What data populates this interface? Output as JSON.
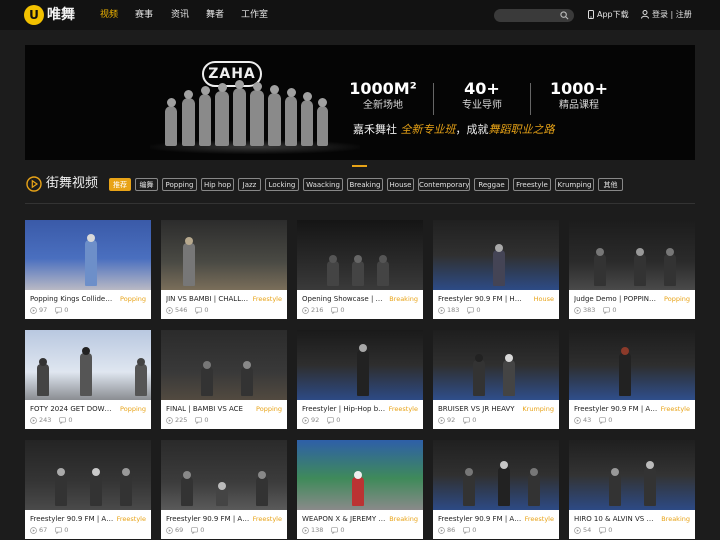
{
  "header": {
    "logo_badge": "U",
    "logo_text": "唯舞",
    "nav": [
      {
        "label": "视频",
        "active": true
      },
      {
        "label": "赛事",
        "active": false
      },
      {
        "label": "资讯",
        "active": false
      },
      {
        "label": "舞者",
        "active": false
      },
      {
        "label": "工作室",
        "active": false
      }
    ],
    "search_placeholder": "",
    "app_download": "App下载",
    "login": "登录 | 注册"
  },
  "banner": {
    "logo": "ZAHA",
    "stats": [
      {
        "num": "1000M²",
        "label": "全新场地"
      },
      {
        "num": "40+",
        "label": "专业导师"
      },
      {
        "num": "1000+",
        "label": "精品课程"
      }
    ],
    "slogan_pre": "嘉禾舞社",
    "slogan_hl1": "全新专业班",
    "slogan_mid": "，成就",
    "slogan_hl2": "舞蹈职业之路"
  },
  "section": {
    "title": "街舞视频",
    "tags": [
      "推荐",
      "编舞",
      "Popping",
      "Hip hop",
      "Jazz",
      "Locking",
      "Waacking",
      "Breaking",
      "House",
      "Contemporary",
      "Reggae",
      "Freestyle",
      "Krumping",
      "其他"
    ]
  },
  "videos": [
    {
      "title": "Popping Kings Collide: Locky vs Xiaohu",
      "tag": "Popping",
      "views": "97",
      "comments": "0"
    },
    {
      "title": "JIN VS BAMBI | CHALLENGE",
      "tag": "Freestyle",
      "views": "546",
      "comments": "0"
    },
    {
      "title": "Opening Showcase | Breaking Battle",
      "tag": "Breaking",
      "views": "216",
      "comments": "0"
    },
    {
      "title": "Freestyler 90.9 FM | House Battle",
      "tag": "House",
      "views": "183",
      "comments": "0"
    },
    {
      "title": "Judge Demo | POPPING BATTLE",
      "tag": "Popping",
      "views": "383",
      "comments": "0"
    },
    {
      "title": "FOTY 2024 GET DOWN POPPING",
      "tag": "Popping",
      "views": "243",
      "comments": "0"
    },
    {
      "title": "FINAL | BAMBI VS ACE",
      "tag": "Popping",
      "views": "225",
      "comments": "0"
    },
    {
      "title": "Freestyler | Hip-Hop battle",
      "tag": "Freestyle",
      "views": "92",
      "comments": "0"
    },
    {
      "title": "BRUISER VS JR HEAVY",
      "tag": "Krumping",
      "views": "92",
      "comments": "0"
    },
    {
      "title": "Freestyler 90.9 FM | All Style",
      "tag": "Freestyle",
      "views": "43",
      "comments": "0"
    },
    {
      "title": "Freestyler 90.9 FM | All Style",
      "tag": "Freestyle",
      "views": "67",
      "comments": "0"
    },
    {
      "title": "Freestyler 90.9 FM | All Style",
      "tag": "Freestyle",
      "views": "69",
      "comments": "0"
    },
    {
      "title": "WEAPON X & JEREMY | BREAKING",
      "tag": "Breaking",
      "views": "138",
      "comments": "0"
    },
    {
      "title": "Freestyler 90.9 FM | All Style",
      "tag": "Freestyle",
      "views": "86",
      "comments": "0"
    },
    {
      "title": "HIRO 10 & ALVIN VS MORRIS",
      "tag": "Breaking",
      "views": "54",
      "comments": "0"
    }
  ],
  "colors": {
    "accent": "#e8a317",
    "nav_active": "#f0b400",
    "topbar": "#121212",
    "page_bg": "#1c1c1c"
  }
}
